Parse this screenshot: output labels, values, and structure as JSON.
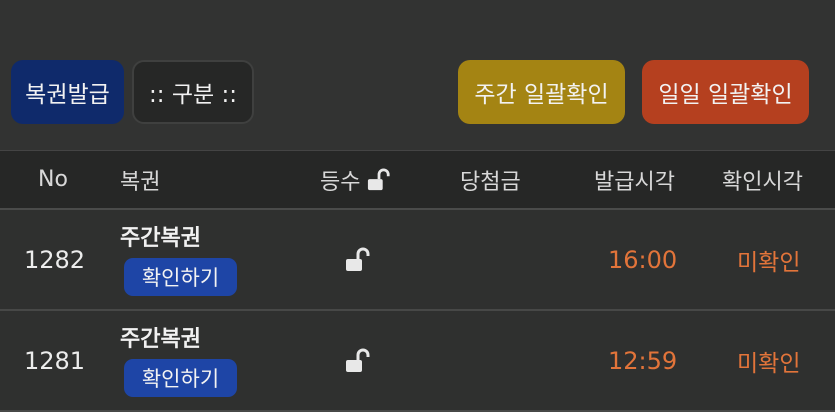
{
  "toolbar": {
    "issue_label": "복권발급",
    "category_label": ":: 구분 ::",
    "weekly_confirm_label": "주간 일괄확인",
    "daily_confirm_label": "일일 일괄확인"
  },
  "table": {
    "headers": {
      "no": "No",
      "ticket": "복권",
      "rank": "등수",
      "prize": "당첨금",
      "issued_time": "발급시각",
      "confirmed_time": "확인시각"
    },
    "rows": [
      {
        "no": "1282",
        "ticket": "주간복권",
        "check_label": "확인하기",
        "rank_icon": "unlock-icon",
        "prize": "",
        "issued_time": "16:00",
        "confirmed_time": "미확인"
      },
      {
        "no": "1281",
        "ticket": "주간복권",
        "check_label": "확인하기",
        "rank_icon": "unlock-icon",
        "prize": "",
        "issued_time": "12:59",
        "confirmed_time": "미확인"
      }
    ]
  },
  "colors": {
    "issue_button": "#0f2a6b",
    "weekly_button": "#a48413",
    "daily_button": "#b5401f",
    "check_button": "#1e45a6",
    "status_text": "#e2743a"
  }
}
